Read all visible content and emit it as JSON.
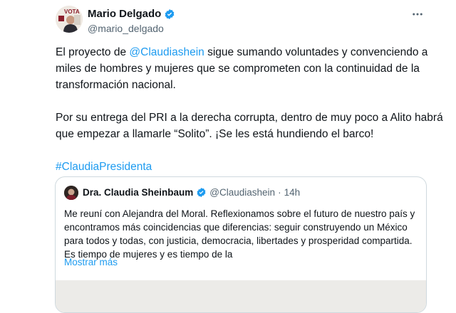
{
  "author": {
    "display_name": "Mario Delgado",
    "handle": "@mario_delgado",
    "avatar_text": "VOTA"
  },
  "tweet": {
    "line1_before": "El proyecto de ",
    "mention": "@Claudiashein",
    "line1_after": " sigue sumando voluntades y convenciendo a miles de hombres y mujeres  que se comprometen con la continuidad de la transformación nacional.",
    "paragraph2": "Por su entrega del PRI a la derecha corrupta, dentro de muy poco a Alito habrá que empezar a llamarle “Solito”.  ¡Se les está hundiendo el barco!",
    "hashtag": "#ClaudiaPresidenta"
  },
  "quoted": {
    "display_name": "Dra. Claudia Sheinbaum",
    "handle": "@Claudiashein",
    "separator": "·",
    "time": "14h",
    "text": "Me reuní con Alejandra del Moral. Reflexionamos sobre el futuro de nuestro país y encontramos más coincidencias que diferencias: seguir construyendo un México para todos y todas, con justicia, democracia, libertades y prosperidad compartida. Es tiempo de mujeres y es tiempo de la",
    "show_more": "Mostrar más"
  },
  "colors": {
    "link": "#1d9bf0",
    "secondary_text": "#536471",
    "primary_text": "#0f1419",
    "border": "#cfd9de"
  },
  "icons": {
    "verified": "verified-badge-icon",
    "more": "more-options-icon"
  }
}
